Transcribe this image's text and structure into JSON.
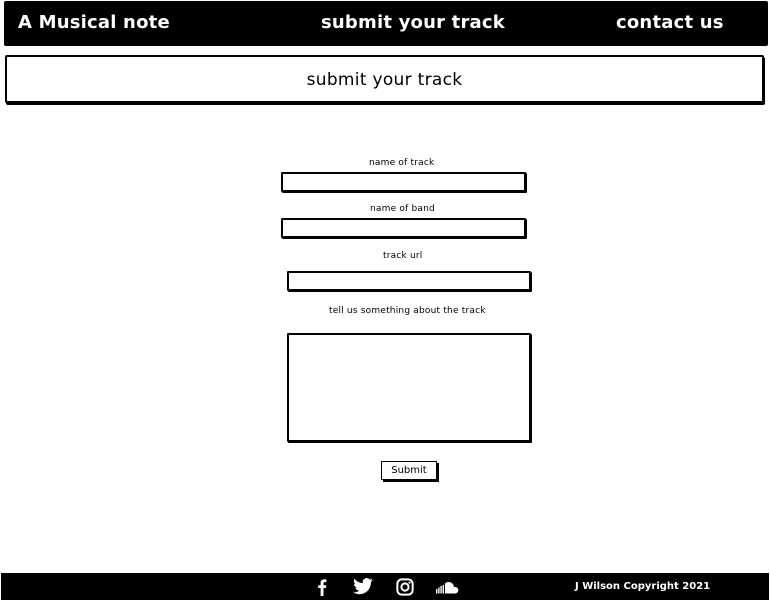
{
  "nav": {
    "brand": "A Musical note",
    "submit": "submit your track",
    "contact": "contact us"
  },
  "header": {
    "title": "submit your track"
  },
  "form": {
    "track_name_label": "name of track",
    "track_name_value": "",
    "band_name_label": "name of band",
    "band_name_value": "",
    "track_url_label": "track url",
    "track_url_value": "",
    "about_label": "tell us something about the track",
    "about_value": "",
    "submit_label": "Submit"
  },
  "footer": {
    "social_icons": [
      "facebook-icon",
      "twitter-icon",
      "instagram-icon",
      "soundcloud-icon"
    ],
    "copyright": "J Wilson Copyright 2021"
  },
  "colors": {
    "nav_background": "#000000",
    "nav_text": "#ffffff",
    "page_background": "#ffffff"
  }
}
